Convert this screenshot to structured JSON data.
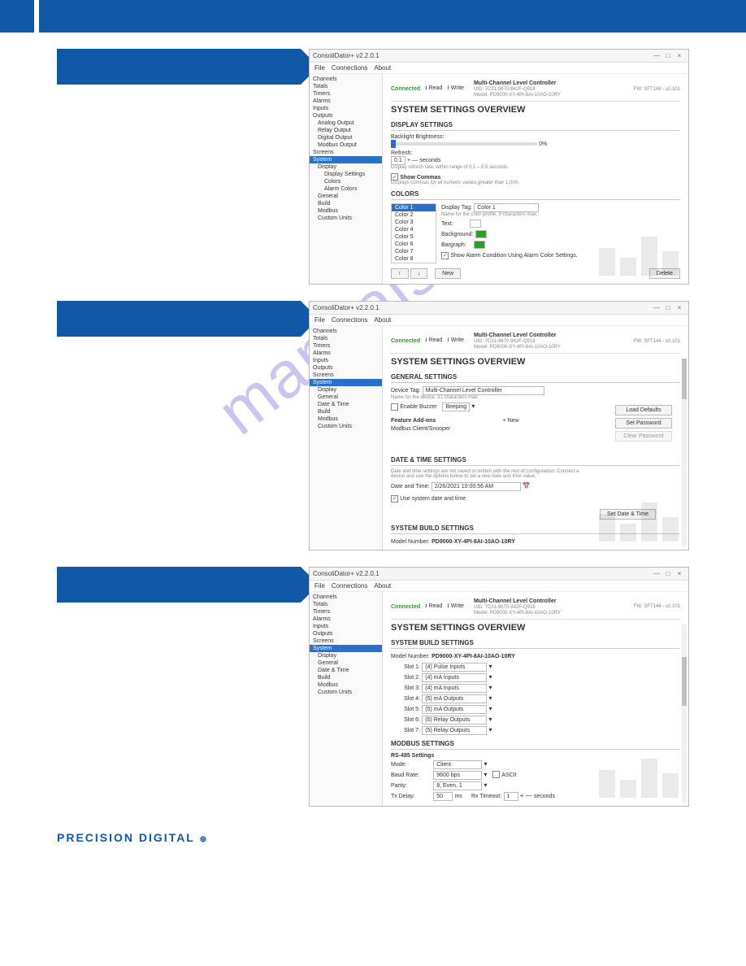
{
  "brand": "PRECISION DIGITAL",
  "watermark": "manualshive.com",
  "app": {
    "title": "ConsoliDator+ v2.2.0.1",
    "menu": [
      "File",
      "Connections",
      "About"
    ],
    "status": "Connected",
    "toolbar_read": "Read",
    "toolbar_write": "Write",
    "device_name": "Multi-Channel Level Controller",
    "device_line1": "UID: 7C31-9670-942F-Q918",
    "device_line2": "Model: PD9000-XY-4PI-8AI-10AO-10RY",
    "fw": "FW: SFT144 - v2.101",
    "overview": "SYSTEM SETTINGS OVERVIEW"
  },
  "tree_common": {
    "channels": "Channels",
    "totals": "Totals",
    "timers": "Timers",
    "alarms": "Alarms",
    "inputs": "Inputs",
    "outputs": "Outputs",
    "analog": "Analog Output",
    "relay": "Relay Output",
    "digital": "Digital Output",
    "modout": "Modbus Output",
    "screens": "Screens",
    "system": "System",
    "display": "Display",
    "dset": "Display Settings",
    "colors": "Colors",
    "alarmcolors": "Alarm Colors",
    "general": "General",
    "datetime": "Date & Time",
    "build": "Build",
    "modbus": "Modbus",
    "custom": "Custom Units"
  },
  "s1": {
    "display_settings": "DISPLAY SETTINGS",
    "backlight": "Backlight Brightness:",
    "pct": "0%",
    "refresh": "Refresh:",
    "refresh_val": "0.1",
    "refresh_unit": "seconds",
    "refresh_hint": "Display refresh rate, within range of 0.1 – 0.5 seconds.",
    "showcommas": "Show Commas",
    "commas_hint": "Displays commas for all numeric values greater than 1,000.",
    "colors": "COLORS",
    "list": [
      "Color 1",
      "Color 2",
      "Color 3",
      "Color 4",
      "Color 5",
      "Color 6",
      "Color 7",
      "Color 8"
    ],
    "disptag": "Display Tag:",
    "disptag_val": "Color 1",
    "disptag_hint": "Name for the color profile. 9 characters max.",
    "text": "Text:",
    "bg": "Background:",
    "bar": "Bargraph:",
    "alarmcond": "Show Alarm Condition Using Alarm Color Settings.",
    "up": "↑",
    "down": "↓",
    "new": "New",
    "delete": "Delete"
  },
  "s2": {
    "general": "GENERAL SETTINGS",
    "devtag": "Device Tag:",
    "devtag_val": "Multi-Channel Level Controller",
    "devtag_hint": "Name for the device. 31 characters max.",
    "buzzer": "Enable Buzzer",
    "beeping": "Beeping",
    "feature": "Feature Add-ons",
    "addnew": "+ New",
    "addon1": "Modbus Client/Snooper",
    "load": "Load Defaults",
    "setpw": "Set Password",
    "clearpw": "Clear Password",
    "dts": "DATE & TIME SETTINGS",
    "dtshint": "Date and time settings are not saved or written with the rest of configuration. Connect a device and use the options below to set a new date and time value.",
    "dt": "Date and Time:",
    "dtval": "2/26/2021 10:00:56 AM",
    "usesys": "Use system date and time.",
    "setdt": "Set Date & Time",
    "sbs": "SYSTEM BUILD SETTINGS",
    "mnlbl": "Model Number:",
    "mn": "PD9000-XY-4PI-8AI-10AO-10RY"
  },
  "s3": {
    "sbs": "SYSTEM BUILD SETTINGS",
    "mnlbl": "Model Number:",
    "mn": "PD9000-XY-4PI-8AI-10AO-10RY",
    "slots": [
      {
        "l": "Slot 1:",
        "v": "(4) Pulse Inputs"
      },
      {
        "l": "Slot 2:",
        "v": "(4) mA Inputs"
      },
      {
        "l": "Slot 3:",
        "v": "(4) mA Inputs"
      },
      {
        "l": "Slot 4:",
        "v": "(5) mA Outputs"
      },
      {
        "l": "Slot 5:",
        "v": "(5) mA Outputs"
      },
      {
        "l": "Slot 6:",
        "v": "(5) Relay Outputs"
      },
      {
        "l": "Slot 7:",
        "v": "(5) Relay Outputs"
      }
    ],
    "modbus": "MODBUS SETTINGS",
    "rs485": "RS-485 Settings",
    "mode": "Mode:",
    "mode_v": "Client",
    "baud": "Baud Rate:",
    "baud_v": "9600 bps",
    "ascii": "ASCII",
    "parity": "Parity:",
    "parity_v": "8, Even, 1",
    "txd": "Tx Delay:",
    "txd_v": "50",
    "ms": "ms",
    "rxt": "Rx Timeout:",
    "rxt_v": "1",
    "sec": "seconds"
  }
}
